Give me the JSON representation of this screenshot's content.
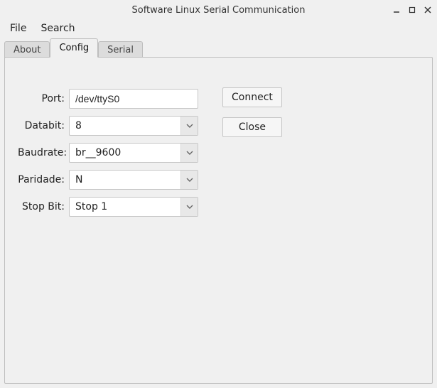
{
  "window": {
    "title": "Software Linux Serial Communication"
  },
  "menu": {
    "file": "File",
    "search": "Search"
  },
  "tabs": {
    "about": "About",
    "config": "Config",
    "serial": "Serial"
  },
  "form": {
    "port_label": "Port:",
    "port_value": "/dev/ttyS0",
    "databit_label": "Databit:",
    "databit_value": "8",
    "baudrate_label": "Baudrate:",
    "baudrate_value": "br__9600",
    "paridade_label": "Paridade:",
    "paridade_value": "N",
    "stopbit_label": "Stop Bit:",
    "stopbit_value": "Stop 1"
  },
  "buttons": {
    "connect": "Connect",
    "close": "Close"
  }
}
